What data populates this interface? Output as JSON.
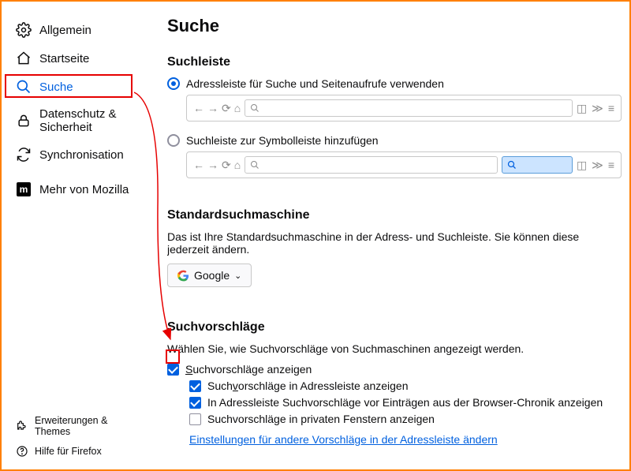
{
  "sidebar": {
    "items": [
      {
        "label": "Allgemein"
      },
      {
        "label": "Startseite"
      },
      {
        "label": "Suche"
      },
      {
        "label": "Datenschutz & Sicherheit"
      },
      {
        "label": "Synchronisation"
      },
      {
        "label": "Mehr von Mozilla"
      }
    ],
    "bottom": [
      {
        "label": "Erweiterungen & Themes"
      },
      {
        "label": "Hilfe für Firefox"
      }
    ]
  },
  "page": {
    "title": "Suche",
    "searchbar": {
      "heading": "Suchleiste",
      "option_combined": "Adressleiste für Suche und Seitenaufrufe verwenden",
      "option_separate": "Suchleiste zur Symbolleiste hinzufügen"
    },
    "default_engine": {
      "heading": "Standardsuchmaschine",
      "desc": "Das ist Ihre Standardsuchmaschine in der Adress- und Suchleiste. Sie können diese jederzeit ändern.",
      "selected": "Google"
    },
    "suggestions": {
      "heading": "Suchvorschläge",
      "desc": "Wählen Sie, wie Suchvorschläge von Suchmaschinen angezeigt werden.",
      "show_label_pre": "S",
      "show_label_rest": "uchvorschläge anzeigen",
      "in_addr_pre": "Such",
      "in_addr_u": "v",
      "in_addr_post": "orschläge in Adressleiste anzeigen",
      "before_history": "In Adressleiste Suchvorschläge vor Einträgen aus der Browser-Chronik anzeigen",
      "private": "Suchvorschläge in privaten Fenstern anzeigen",
      "link": "Einstellungen für andere Vorschläge in der Adressleiste ändern"
    }
  }
}
